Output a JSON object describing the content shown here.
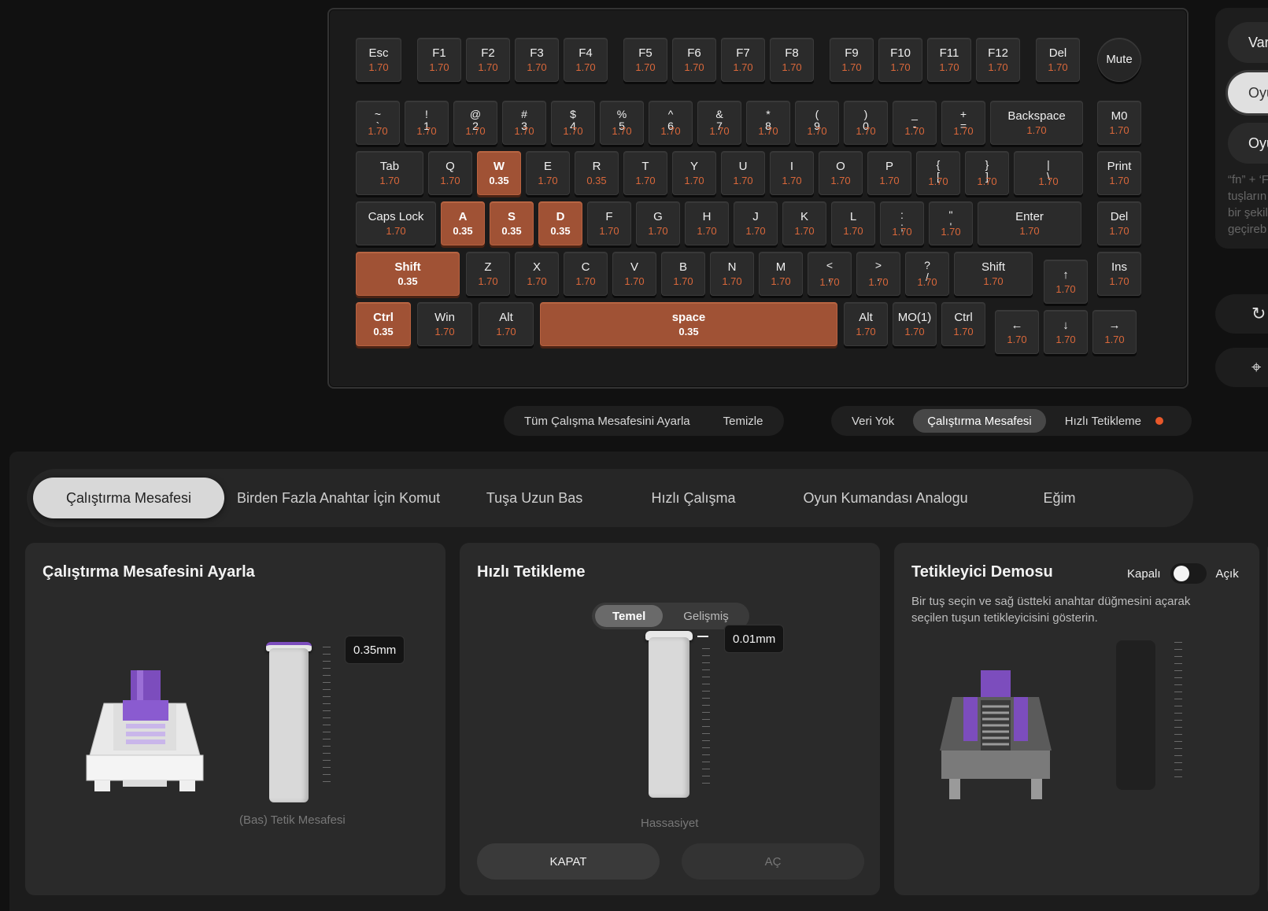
{
  "keyboard": {
    "rows": [
      [
        {
          "l": "Esc",
          "v": "1.70"
        },
        {
          "l": "F1",
          "v": "1.70"
        },
        {
          "l": "F2",
          "v": "1.70"
        },
        {
          "l": "F3",
          "v": "1.70"
        },
        {
          "l": "F4",
          "v": "1.70"
        },
        {
          "l": "F5",
          "v": "1.70"
        },
        {
          "l": "F6",
          "v": "1.70"
        },
        {
          "l": "F7",
          "v": "1.70"
        },
        {
          "l": "F8",
          "v": "1.70"
        },
        {
          "l": "F9",
          "v": "1.70"
        },
        {
          "l": "F10",
          "v": "1.70"
        },
        {
          "l": "F11",
          "v": "1.70"
        },
        {
          "l": "F12",
          "v": "1.70"
        },
        {
          "l": "Del",
          "v": "1.70"
        },
        {
          "l": "Mute",
          "v": ""
        }
      ],
      [
        {
          "l": "~\n`",
          "v": "1.70"
        },
        {
          "l": "!\n1",
          "v": "1.70"
        },
        {
          "l": "@\n2",
          "v": "1.70"
        },
        {
          "l": "#\n3",
          "v": "1.70"
        },
        {
          "l": "$\n4",
          "v": "1.70"
        },
        {
          "l": "%\n5",
          "v": "1.70"
        },
        {
          "l": "^\n6",
          "v": "1.70"
        },
        {
          "l": "&\n7",
          "v": "1.70"
        },
        {
          "l": "*\n8",
          "v": "1.70"
        },
        {
          "l": "(\n9",
          "v": "1.70"
        },
        {
          "l": ")\n0",
          "v": "1.70"
        },
        {
          "l": "_\n-",
          "v": "1.70"
        },
        {
          "l": "+\n=",
          "v": "1.70"
        },
        {
          "l": "Backspace",
          "v": "1.70"
        },
        {
          "l": "M0",
          "v": "1.70"
        }
      ],
      [
        {
          "l": "Tab",
          "v": "1.70"
        },
        {
          "l": "Q",
          "v": "1.70"
        },
        {
          "l": "W",
          "v": "0.35",
          "sel": true
        },
        {
          "l": "E",
          "v": "1.70"
        },
        {
          "l": "R",
          "v": "0.35"
        },
        {
          "l": "T",
          "v": "1.70"
        },
        {
          "l": "Y",
          "v": "1.70"
        },
        {
          "l": "U",
          "v": "1.70"
        },
        {
          "l": "I",
          "v": "1.70"
        },
        {
          "l": "O",
          "v": "1.70"
        },
        {
          "l": "P",
          "v": "1.70"
        },
        {
          "l": "{\n[",
          "v": "1.70"
        },
        {
          "l": "}\n]",
          "v": "1.70"
        },
        {
          "l": "|\n\\",
          "v": "1.70"
        },
        {
          "l": "Print",
          "v": "1.70"
        }
      ],
      [
        {
          "l": "Caps Lock",
          "v": "1.70"
        },
        {
          "l": "A",
          "v": "0.35",
          "sel": true
        },
        {
          "l": "S",
          "v": "0.35",
          "sel": true
        },
        {
          "l": "D",
          "v": "0.35",
          "sel": true
        },
        {
          "l": "F",
          "v": "1.70"
        },
        {
          "l": "G",
          "v": "1.70"
        },
        {
          "l": "H",
          "v": "1.70"
        },
        {
          "l": "J",
          "v": "1.70"
        },
        {
          "l": "K",
          "v": "1.70"
        },
        {
          "l": "L",
          "v": "1.70"
        },
        {
          "l": ":\n;",
          "v": "1.70"
        },
        {
          "l": "\"\n'",
          "v": "1.70"
        },
        {
          "l": "Enter",
          "v": "1.70"
        },
        {
          "l": "Del",
          "v": "1.70"
        }
      ],
      [
        {
          "l": "Shift",
          "v": "0.35",
          "sel": true
        },
        {
          "l": "Z",
          "v": "1.70"
        },
        {
          "l": "X",
          "v": "1.70"
        },
        {
          "l": "C",
          "v": "1.70"
        },
        {
          "l": "V",
          "v": "1.70"
        },
        {
          "l": "B",
          "v": "1.70"
        },
        {
          "l": "N",
          "v": "1.70"
        },
        {
          "l": "M",
          "v": "1.70"
        },
        {
          "l": "<\n,",
          "v": "1.70"
        },
        {
          "l": ">\n.",
          "v": "1.70"
        },
        {
          "l": "?\n/",
          "v": "1.70"
        },
        {
          "l": "Shift",
          "v": "1.70"
        },
        {
          "l": "↑",
          "v": "1.70"
        },
        {
          "l": "Ins",
          "v": "1.70"
        }
      ],
      [
        {
          "l": "Ctrl",
          "v": "0.35",
          "sel": true
        },
        {
          "l": "Win",
          "v": "1.70"
        },
        {
          "l": "Alt",
          "v": "1.70"
        },
        {
          "l": "space",
          "v": "0.35",
          "sel": true
        },
        {
          "l": "Alt",
          "v": "1.70"
        },
        {
          "l": "MO(1)",
          "v": "1.70"
        },
        {
          "l": "Ctrl",
          "v": "1.70"
        },
        {
          "l": "←",
          "v": "1.70"
        },
        {
          "l": "↓",
          "v": "1.70"
        },
        {
          "l": "→",
          "v": "1.70"
        }
      ]
    ]
  },
  "toolbar_left": {
    "set_all": "Tüm Çalışma Mesafesini Ayarla",
    "clear": "Temizle"
  },
  "toolbar_right": {
    "no_data": "Veri Yok",
    "actuation": "Çalıştırma Mesafesi",
    "rapid": "Hızlı Tetikleme"
  },
  "side": {
    "pill1": "Var",
    "pill2": "Oyu",
    "pill3": "Oyu",
    "note": [
      "“fn” + ‘F",
      "tuşların",
      "bir şekil",
      "geçireb"
    ]
  },
  "tabs": [
    "Çalıştırma Mesafesi",
    "Birden Fazla Anahtar İçin Komut",
    "Tuşa Uzun Bas",
    "Hızlı Çalışma",
    "Oyun Kumandası Analogu",
    "Eğim"
  ],
  "card1": {
    "title": "Çalıştırma Mesafesini Ayarla",
    "value": "0.35mm",
    "label": "(Bas) Tetik Mesafesi"
  },
  "card2": {
    "title": "Hızlı Tetikleme",
    "seg_basic": "Temel",
    "seg_adv": "Gelişmiş",
    "value": "0.01mm",
    "label": "Hassasiyet",
    "off": "KAPAT",
    "on": "AÇ"
  },
  "card3": {
    "title": "Tetikleyici Demosu",
    "off": "Kapalı",
    "on": "Açık",
    "desc1": "Bir tuş seçin ve sağ üstteki anahtar düğmesini açarak",
    "desc2": "seçilen tuşun tetikleyicisini gösterin."
  },
  "colors": {
    "accent": "#a05235",
    "value_text": "#d9673a",
    "dot": "#e8582a",
    "switch_purple": "#7c4dbd"
  }
}
